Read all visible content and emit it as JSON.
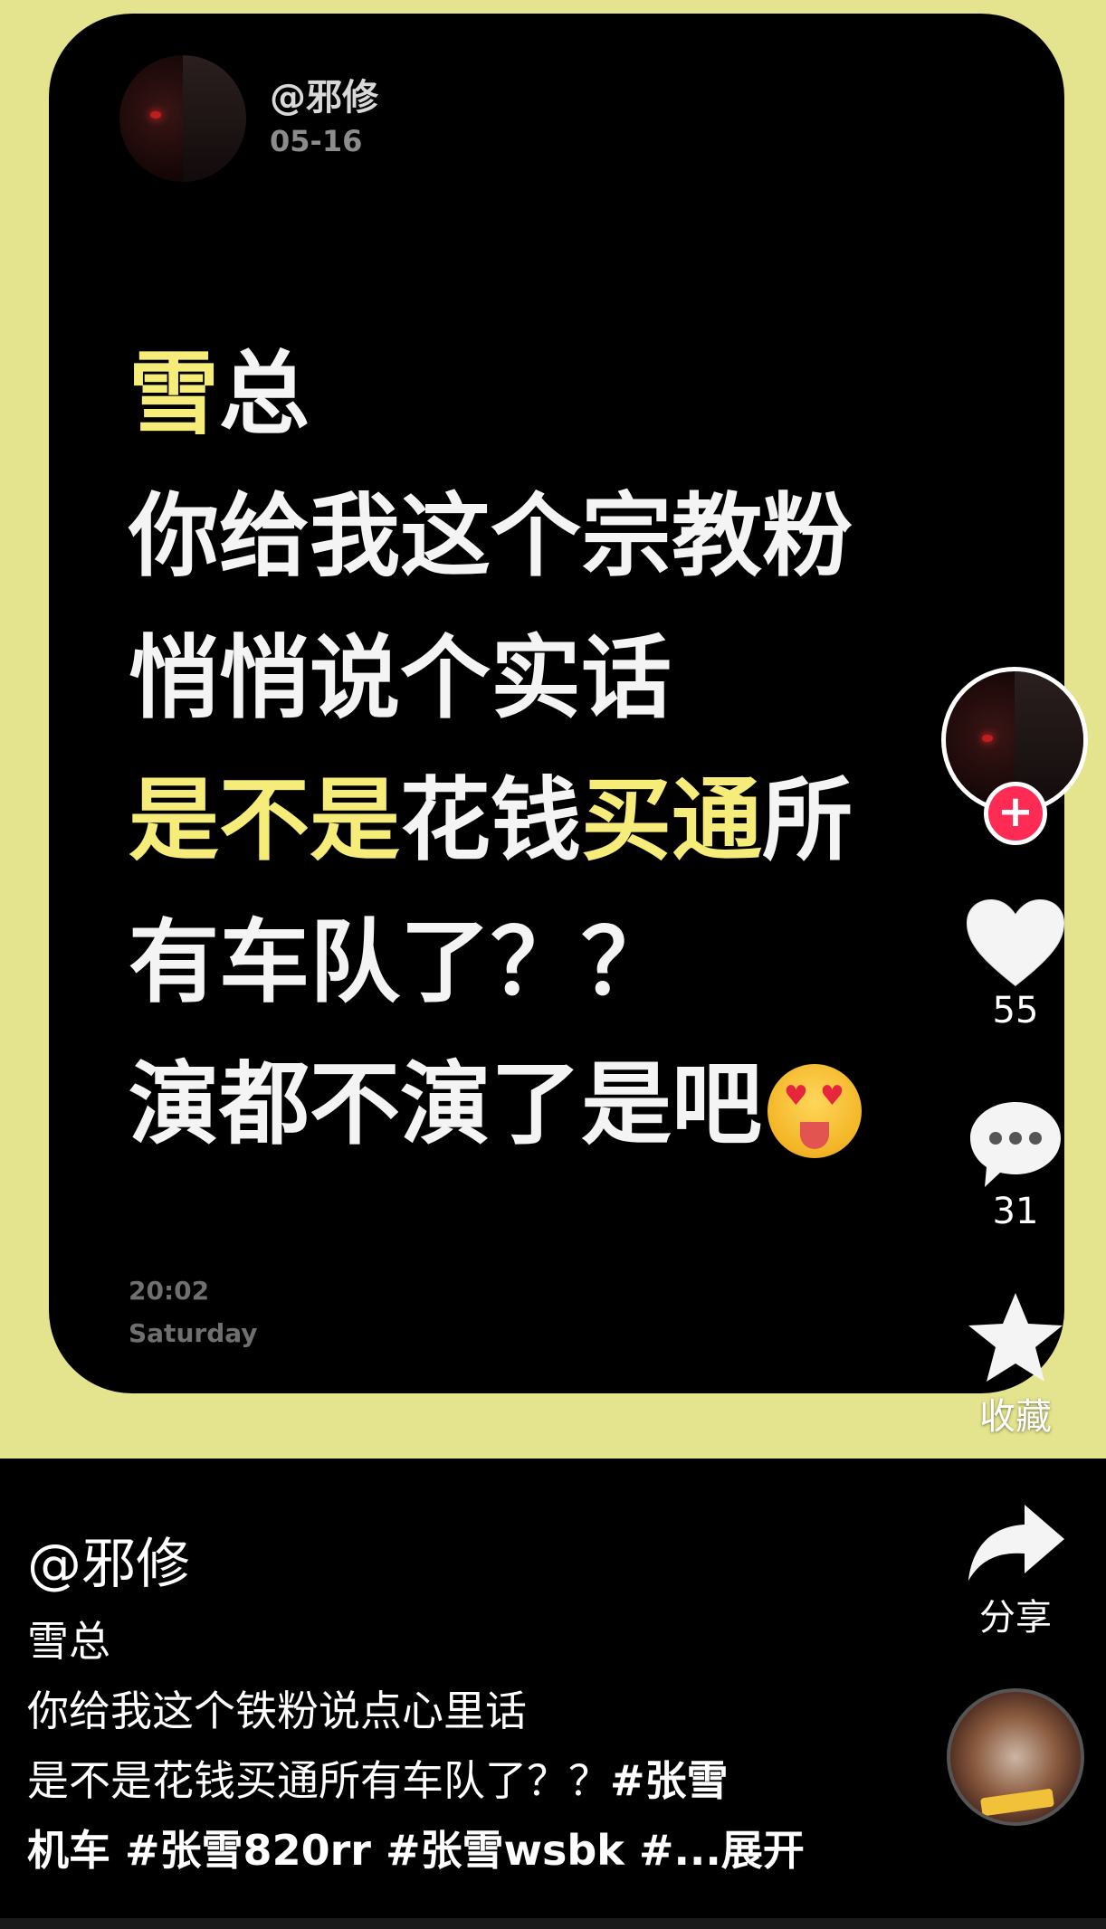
{
  "card": {
    "author": "@邪修",
    "date": "05-16",
    "lines": [
      [
        {
          "t": "雪",
          "hl": true
        },
        {
          "t": "总",
          "hl": false
        }
      ],
      [
        {
          "t": "你给我这个宗教粉",
          "hl": false
        }
      ],
      [
        {
          "t": "悄悄说个实话",
          "hl": false
        }
      ],
      [
        {
          "t": "是不是",
          "hl": true
        },
        {
          "t": "花钱",
          "hl": false
        },
        {
          "t": "买通",
          "hl": true
        },
        {
          "t": "所",
          "hl": false
        }
      ],
      [
        {
          "t": "有车队了？？",
          "hl": false
        }
      ],
      [
        {
          "t": "演都不演了是吧",
          "hl": false
        }
      ]
    ],
    "time": "20:02",
    "day": "Saturday"
  },
  "side": {
    "follow_label": "+",
    "likes": "55",
    "comments": "31",
    "favorite_label": "收藏",
    "share_label": "分享"
  },
  "post": {
    "author": "@邪修",
    "desc_lines": [
      "雪总",
      "你给我这个铁粉说点心里话"
    ],
    "desc_last_plain": "是不是花钱买通所有车队了？？",
    "tags_line1": "#张雪",
    "tags_line2": "机车 #张雪820rr #张雪wsbk #...展开"
  },
  "colors": {
    "background_top": "#e3e48d",
    "highlight": "#f6ec7a",
    "follow": "#fe2c55"
  },
  "icons": [
    "heart-icon",
    "comment-icon",
    "star-icon",
    "share-icon",
    "plus-icon",
    "music-disc-icon"
  ]
}
